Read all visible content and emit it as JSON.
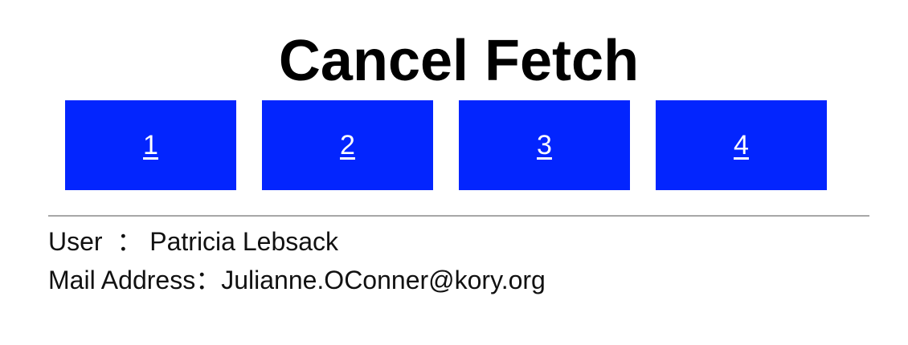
{
  "header": {
    "title": "Cancel Fetch"
  },
  "nav": {
    "buttons": [
      {
        "label": "1"
      },
      {
        "label": "2"
      },
      {
        "label": "3"
      },
      {
        "label": "4"
      }
    ]
  },
  "info": {
    "user_label": "User  ： ",
    "user_value": "Patricia Lebsack",
    "mail_label": "Mail Address：",
    "mail_value": "Julianne.OConner@kory.org"
  },
  "colors": {
    "button_bg": "#0325fe",
    "button_text": "#ffffff",
    "divider": "#a7a7a7"
  }
}
